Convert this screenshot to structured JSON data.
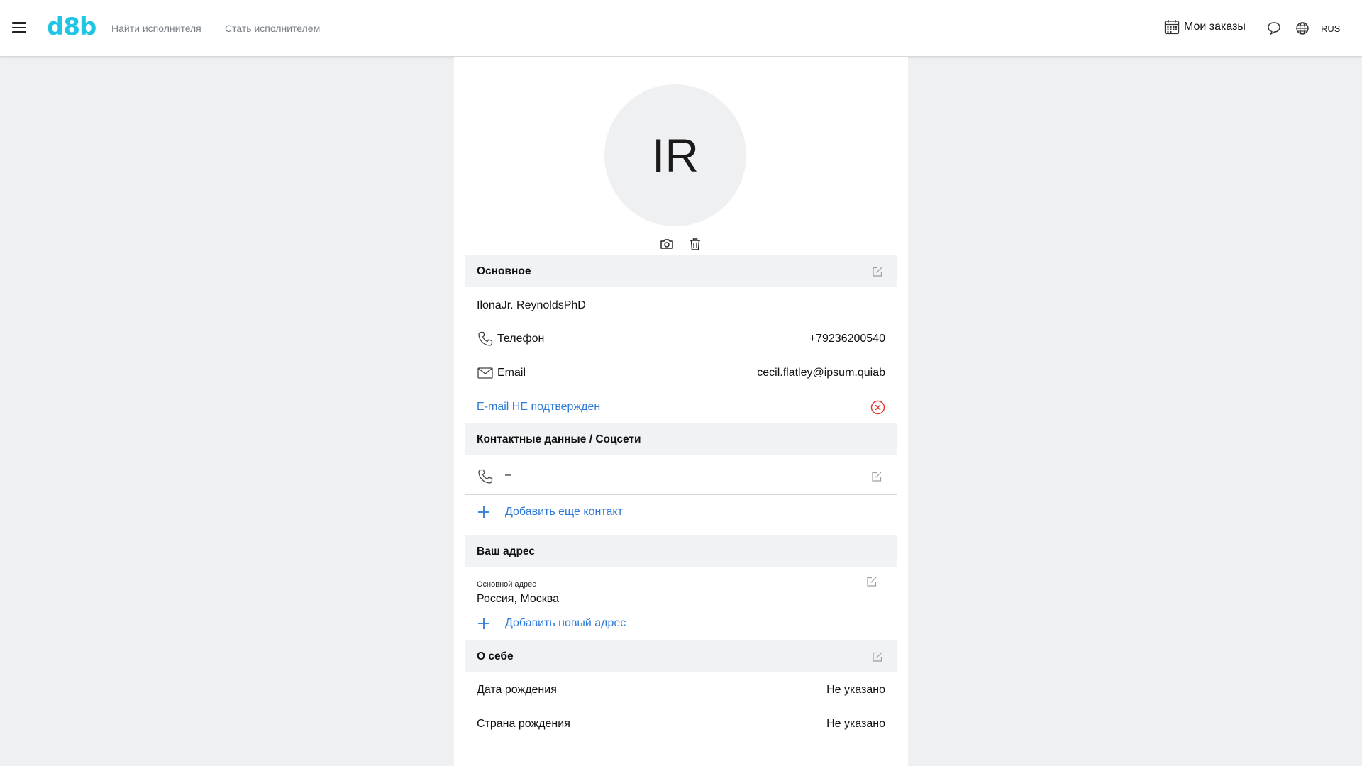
{
  "header": {
    "logo": "d8b",
    "nav": [
      "Найти исполнителя",
      "Стать исполнителем"
    ],
    "orders_label": "Мои заказы",
    "language": "RUS"
  },
  "avatar": {
    "initials": "IR"
  },
  "basic": {
    "title": "Основное",
    "name": "IlonaJr. ReynoldsPhD",
    "phone_label": "Телефон",
    "phone_value": "+79236200540",
    "email_label": "Email",
    "email_value": "cecil.flatley@ipsum.quiab",
    "email_status": "E-mail НЕ подтвержден"
  },
  "contacts": {
    "title": "Контактные данные / Соцсети",
    "items": [
      {
        "value": "–"
      }
    ],
    "add_label": "Добавить еще контакт"
  },
  "address": {
    "title": "Ваш адрес",
    "main_label": "Основной адрес",
    "main_value": "Россия, Москва",
    "add_label": "Добавить новый адрес"
  },
  "about": {
    "title": "О себе",
    "birth_date_label": "Дата рождения",
    "birth_date_value": "Не указано",
    "birth_country_label": "Страна рождения",
    "birth_country_value": "Не указано"
  },
  "colors": {
    "accent": "#2f7bd6",
    "logo": "#20c5e4",
    "error": "#e53935",
    "background": "#eff0f2"
  },
  "icons": [
    "menu-icon",
    "calendar-icon",
    "chat-icon",
    "globe-icon",
    "camera-icon",
    "trash-icon",
    "edit-icon",
    "phone-icon",
    "mail-icon",
    "error-circle-icon",
    "plus-icon"
  ]
}
